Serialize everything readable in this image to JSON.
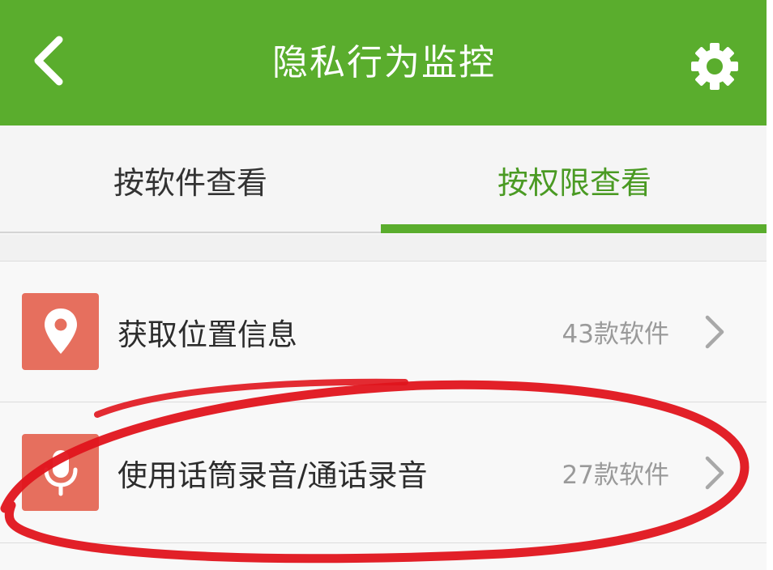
{
  "header": {
    "title": "隐私行为监控",
    "back_icon": "chevron-left-icon",
    "settings_icon": "gear-icon",
    "background_color": "#5aad2d"
  },
  "tabs": [
    {
      "label": "按软件查看",
      "active": false
    },
    {
      "label": "按权限查看",
      "active": true
    }
  ],
  "accent_color": "#5aad2d",
  "list": {
    "items": [
      {
        "icon": "location-pin-icon",
        "label": "获取位置信息",
        "count": "43款软件"
      },
      {
        "icon": "microphone-icon",
        "label": "使用话筒录音/通话录音",
        "count": "27款软件"
      }
    ]
  },
  "annotation": {
    "type": "hand-drawn-circle",
    "color": "#e0141c",
    "target": "list.items.1"
  }
}
